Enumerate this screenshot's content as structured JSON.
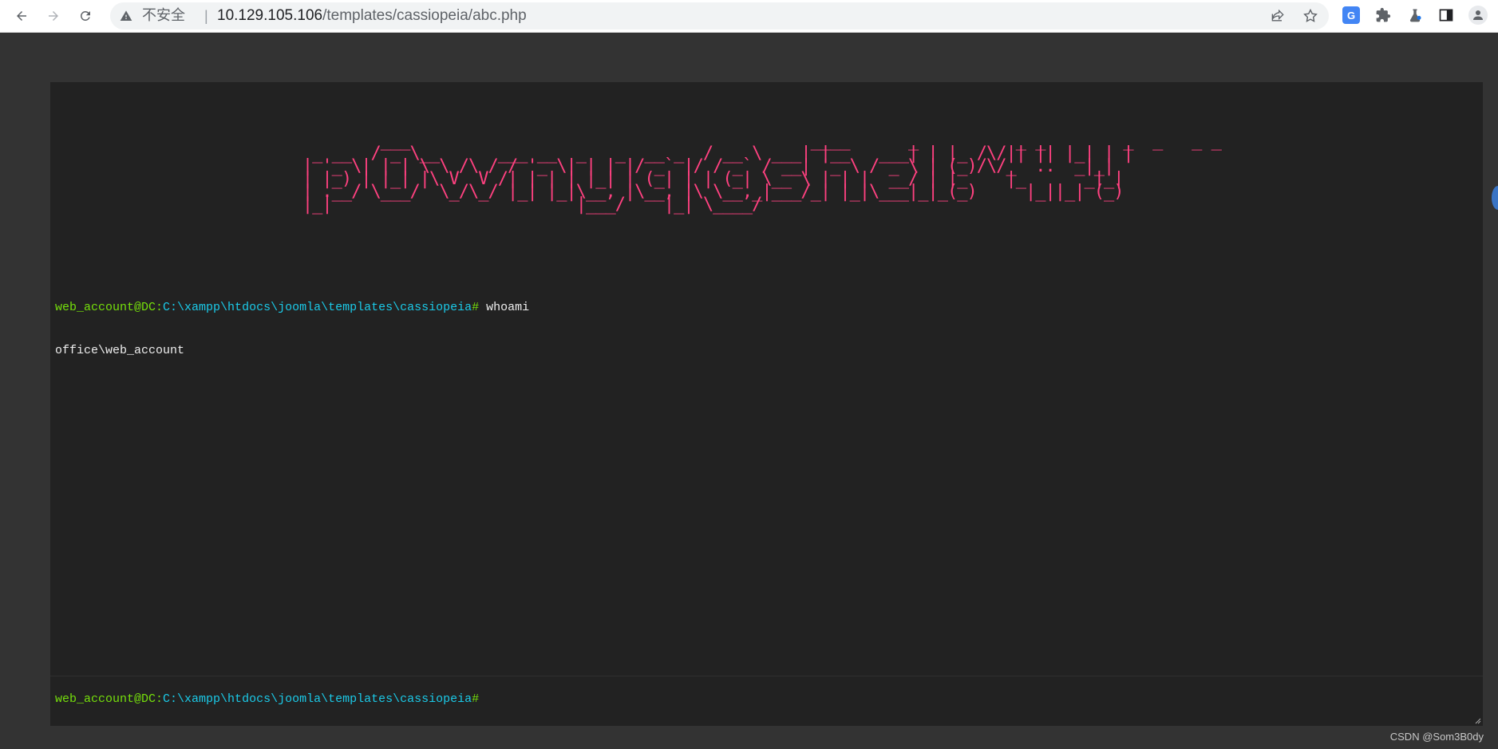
{
  "browser": {
    "security_label": "不安全",
    "separator": "|",
    "url_host": "10.129.105.106",
    "url_path": "/templates/cassiopeia/abc.php",
    "icons": [
      "back-icon",
      "forward-icon",
      "reload-icon",
      "warning-icon",
      "share-icon",
      "bookmark-star-icon",
      "google-translate-icon",
      "extensions-icon",
      "labs-icon",
      "side-panel-icon",
      "profile-icon"
    ],
    "translate_badge": "G"
  },
  "terminal": {
    "banner": "        ___                                         ____      _          _ _        _  _   _ _ \n _ __  / _ \\__      ___ __  _   _  __ _  / __ \\ ___| |__   ___| | |_ /\\/|| || |_| | |\n| '_ \\| | | \\ \\ /\\ / / '_ \\| | | |/ _` |/ / _` / __| '_ \\ / _ \\ | (_)/\\/_  ..  _|_|\n| |_) | |_| |\\ V  V /| | | | |_| | (_| | | (_| \\__ \\ | | |  __/ | |_    |_      _|_|\n| .__/ \\___/  \\_/\\_/ |_| |_|\\__, |\\__, |\\ \\__,_|___/_| |_|\\___|_|_(_)     |_||_| (_)\n|_|                         |___/    |_| \\____/                                        ",
    "colors": {
      "user": "#75df0b",
      "cwd": "#1bc9e7",
      "banner": "#ff4180",
      "background": "#222222"
    },
    "history": [
      {
        "user": "web_account@DC",
        "colon": ":",
        "cwd": "C:\\xampp\\htdocs\\joomla\\templates\\cassiopeia",
        "hash": "#",
        "command": " whoami",
        "output": "office\\web_account"
      }
    ],
    "prompt": {
      "user": "web_account@DC",
      "colon": ":",
      "cwd": "C:\\xampp\\htdocs\\joomla\\templates\\cassiopeia",
      "hash": "#"
    },
    "input_value": ""
  },
  "watermark": "CSDN @Som3B0dy"
}
